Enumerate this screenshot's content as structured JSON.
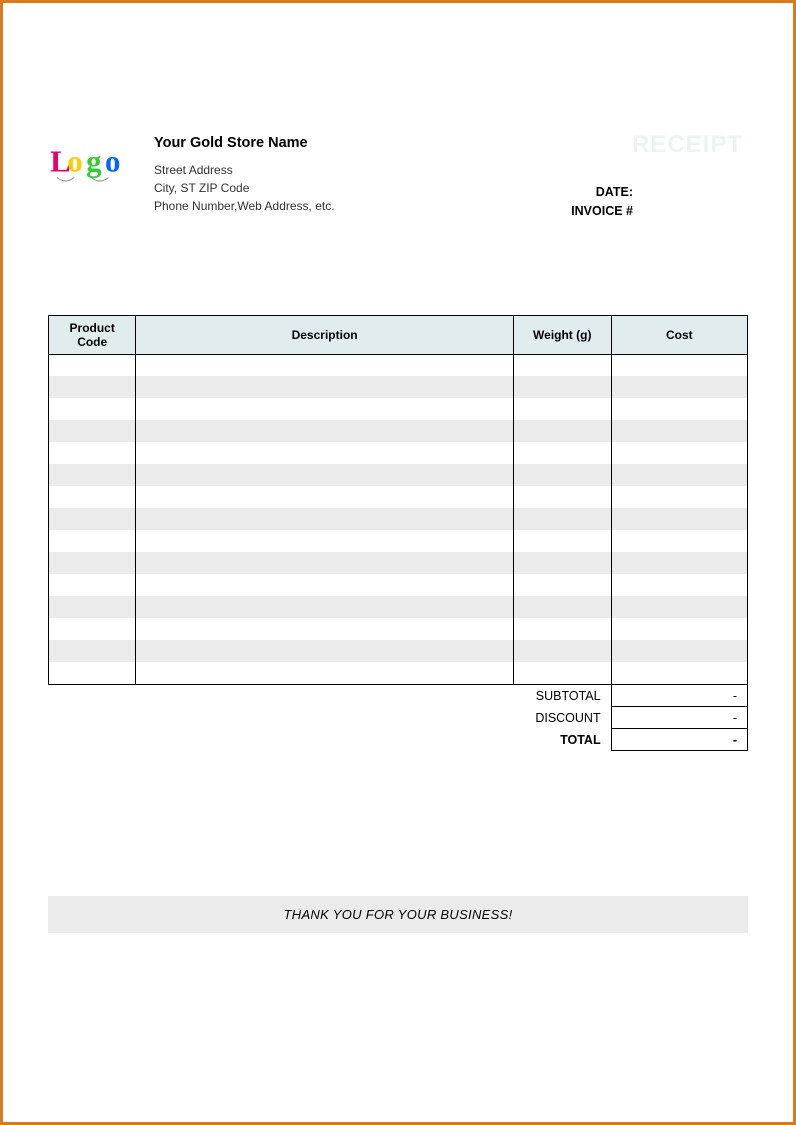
{
  "header": {
    "store_name": "Your Gold Store Name",
    "address_line1": "Street Address",
    "address_line2": "City, ST  ZIP Code",
    "contact_line": "Phone Number,Web Address, etc.",
    "receipt_watermark": "RECEIPT",
    "date_label": "DATE:",
    "invoice_label": "INVOICE #"
  },
  "table": {
    "columns": {
      "code": "Product Code",
      "description": "Description",
      "weight": "Weight (g)",
      "cost": "Cost"
    },
    "rows": [
      {
        "code": "",
        "description": "",
        "weight": "",
        "cost": ""
      },
      {
        "code": "",
        "description": "",
        "weight": "",
        "cost": ""
      },
      {
        "code": "",
        "description": "",
        "weight": "",
        "cost": ""
      },
      {
        "code": "",
        "description": "",
        "weight": "",
        "cost": ""
      },
      {
        "code": "",
        "description": "",
        "weight": "",
        "cost": ""
      },
      {
        "code": "",
        "description": "",
        "weight": "",
        "cost": ""
      },
      {
        "code": "",
        "description": "",
        "weight": "",
        "cost": ""
      },
      {
        "code": "",
        "description": "",
        "weight": "",
        "cost": ""
      },
      {
        "code": "",
        "description": "",
        "weight": "",
        "cost": ""
      },
      {
        "code": "",
        "description": "",
        "weight": "",
        "cost": ""
      },
      {
        "code": "",
        "description": "",
        "weight": "",
        "cost": ""
      },
      {
        "code": "",
        "description": "",
        "weight": "",
        "cost": ""
      },
      {
        "code": "",
        "description": "",
        "weight": "",
        "cost": ""
      },
      {
        "code": "",
        "description": "",
        "weight": "",
        "cost": ""
      },
      {
        "code": "",
        "description": "",
        "weight": "",
        "cost": ""
      }
    ]
  },
  "totals": {
    "subtotal_label": "SUBTOTAL",
    "subtotal_value": "-",
    "discount_label": "DISCOUNT",
    "discount_value": "-",
    "total_label": "TOTAL",
    "total_value": "-"
  },
  "footer": {
    "thank_you": "THANK YOU FOR YOUR BUSINESS!"
  }
}
